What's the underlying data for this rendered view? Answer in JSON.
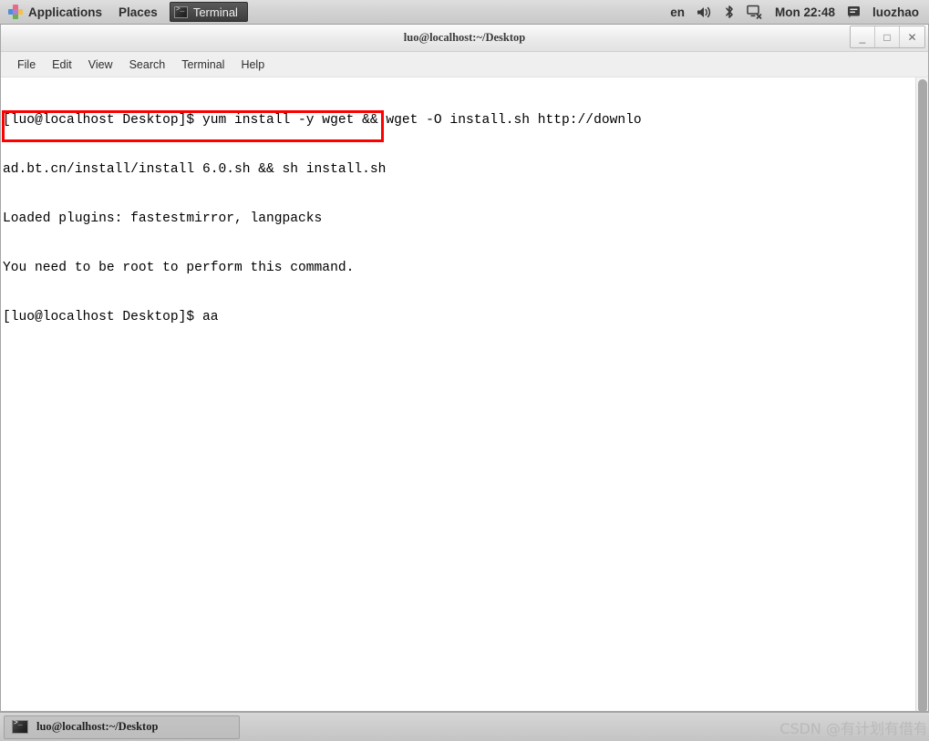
{
  "top_panel": {
    "apps_label": "Applications",
    "apps_icon": "applications-pinwheel-icon",
    "places_label": "Places",
    "window_item": {
      "label": "Terminal",
      "icon": "terminal-icon"
    },
    "tray": {
      "keyboard_layout": "en",
      "volume_icon": "volume-icon",
      "bluetooth_icon": "bluetooth-icon",
      "network_icon": "network-disconnected-icon",
      "clock": "Mon 22:48",
      "user_icon": "message-icon",
      "user_name": "luozhao"
    }
  },
  "terminal_window": {
    "title": "luo@localhost:~/Desktop",
    "controls": {
      "minimize": "_",
      "maximize": "□",
      "close": "✕"
    },
    "menus": [
      "File",
      "Edit",
      "View",
      "Search",
      "Terminal",
      "Help"
    ],
    "lines": [
      "[luo@localhost Desktop]$ yum install -y wget && wget -O install.sh http://downlo",
      "ad.bt.cn/install/install 6.0.sh && sh install.sh",
      "Loaded plugins: fastestmirror, langpacks",
      "You need to be root to perform this command.",
      "[luo@localhost Desktop]$ aa"
    ],
    "annotation": {
      "type": "red-rectangle-highlight",
      "color": "#ff0000",
      "covers_lines": [
        2,
        3
      ]
    }
  },
  "bottom_panel": {
    "task": {
      "label": "luo@localhost:~/Desktop",
      "icon": "terminal-icon"
    },
    "watermark": "CSDN @有计划有借",
    "watermark_cut": "有"
  }
}
